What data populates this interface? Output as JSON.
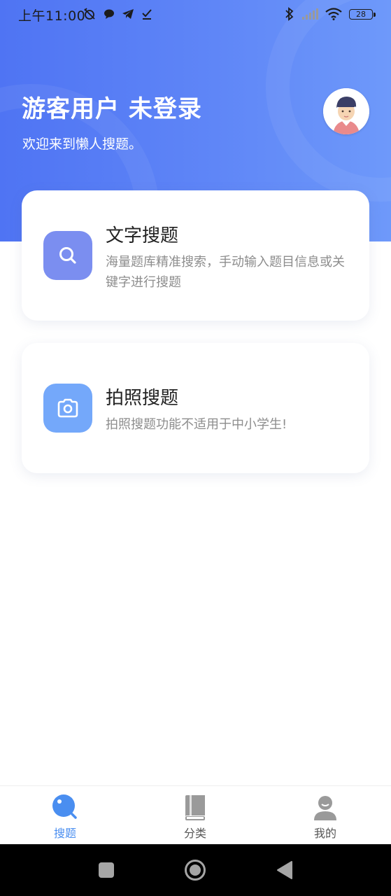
{
  "status_bar": {
    "time": "上午11:00",
    "battery": "28"
  },
  "header": {
    "user_title": "游客用户 未登录",
    "welcome": "欢迎来到懒人搜题。",
    "colors": {
      "gradient_start": "#4f74f3",
      "gradient_end": "#6e99fa"
    }
  },
  "cards": [
    {
      "title": "文字搜题",
      "desc": "海量题库精准搜索，手动输入题目信息或关键字进行搜题",
      "icon": "search-icon",
      "icon_color": "#7b8ef0"
    },
    {
      "title": "拍照搜题",
      "desc": "拍照搜题功能不适用于中小学生!",
      "icon": "camera-icon",
      "icon_color": "#74a8fa"
    }
  ],
  "tabbar": {
    "tabs": [
      {
        "label": "搜题",
        "icon": "search-tab-icon",
        "active": true
      },
      {
        "label": "分类",
        "icon": "book-icon",
        "active": false
      },
      {
        "label": "我的",
        "icon": "user-icon",
        "active": false
      }
    ],
    "active_color": "#4a8ef0",
    "inactive_color": "#555555"
  },
  "nav_bar": {
    "buttons": [
      "recents-button",
      "home-button",
      "back-button"
    ]
  }
}
